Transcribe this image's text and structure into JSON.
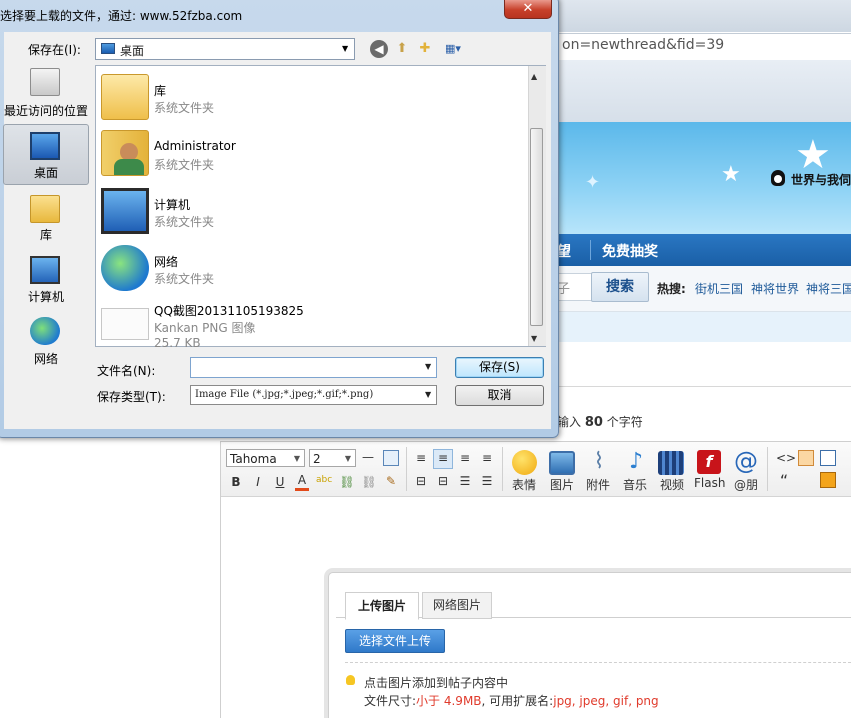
{
  "browser": {
    "url_fragment": "on=newthread&fid=39"
  },
  "site": {
    "qq_text": "世界与我伺",
    "nav": {
      "prev_partial": "望",
      "lottery": "免费抽奖"
    },
    "search": {
      "box_partial": "子",
      "button": "搜索"
    },
    "hot": {
      "label": "热搜:",
      "items": [
        "街机三国",
        "神将世界",
        "神将三国"
      ]
    },
    "char_hint": {
      "prefix": "输入",
      "count": "80",
      "suffix": "个字符"
    }
  },
  "editor": {
    "font_select": "Tahoma",
    "size_select": "2",
    "format_buttons": [
      "B",
      "I",
      "U",
      "A"
    ],
    "insert_buttons": [
      {
        "label": "表情",
        "icon": "smiley-icon"
      },
      {
        "label": "图片",
        "icon": "image-icon"
      },
      {
        "label": "附件",
        "icon": "paperclip-icon"
      },
      {
        "label": "音乐",
        "icon": "music-note-icon"
      },
      {
        "label": "视频",
        "icon": "video-icon"
      },
      {
        "label": "Flash",
        "icon": "flash-icon"
      },
      {
        "label": "@朋",
        "icon": "at-icon"
      }
    ]
  },
  "upload_panel": {
    "tabs": [
      "上传图片",
      "网络图片"
    ],
    "choose_button": "选择文件上传",
    "tip_line1": "点击图片添加到帖子内容中",
    "tip_line2": {
      "prefix": "文件尺寸:",
      "size": "小于 4.9MB",
      "mid": ", 可用扩展名:",
      "ext": "jpg, jpeg, gif, png"
    }
  },
  "dialog": {
    "title": "选择要上载的文件，通过: www.52fzba.com",
    "close": "✕",
    "save_in_label": "保存在(I):",
    "save_in_value": "桌面",
    "places": [
      "最近访问的位置",
      "桌面",
      "库",
      "计算机",
      "网络"
    ],
    "files": [
      {
        "name": "库",
        "type": "系统文件夹"
      },
      {
        "name": "Administrator",
        "type": "系统文件夹"
      },
      {
        "name": "计算机",
        "type": "系统文件夹"
      },
      {
        "name": "网络",
        "type": "系统文件夹"
      },
      {
        "name": "QQ截图20131105193825",
        "type": "Kankan PNG 图像",
        "size": "25.7 KB"
      }
    ],
    "filename_label": "文件名(N):",
    "filename_value": "",
    "filetype_label": "保存类型(T):",
    "filetype_value": "Image File (*.jpg;*.jpeg;*.gif;*.png)",
    "save_button": "保存(S)",
    "cancel_button": "取消"
  }
}
